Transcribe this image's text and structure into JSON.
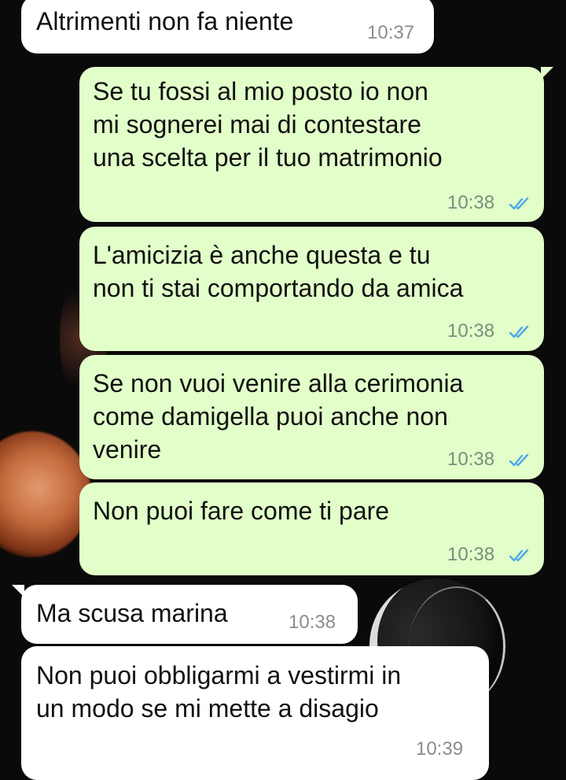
{
  "messages": [
    {
      "id": "m1",
      "direction": "in",
      "text": "Altrimenti non fa niente",
      "time": "10:37"
    },
    {
      "id": "m2",
      "direction": "out",
      "text": "Se tu fossi al mio posto io non\nmi sognerei mai di contestare\nuna scelta per il tuo matrimonio",
      "time": "10:38",
      "status": "read"
    },
    {
      "id": "m3",
      "direction": "out",
      "text": "L'amicizia è anche questa e tu\nnon ti stai comportando da amica",
      "time": "10:38",
      "status": "read"
    },
    {
      "id": "m4",
      "direction": "out",
      "text": "Se non vuoi venire alla cerimonia\ncome damigella puoi anche non\nvenire",
      "time": "10:38",
      "status": "read"
    },
    {
      "id": "m5",
      "direction": "out",
      "text": "Non puoi fare come ti pare",
      "time": "10:38",
      "status": "read"
    },
    {
      "id": "m6",
      "direction": "in",
      "text": "Ma scusa marina",
      "time": "10:38"
    },
    {
      "id": "m7",
      "direction": "in",
      "text": "Non puoi obbligarmi a vestirmi in\nun modo se mi mette a disagio",
      "time": "10:39"
    }
  ],
  "colors": {
    "incoming_bubble": "#ffffff",
    "outgoing_bubble": "#e2fec9",
    "read_ticks": "#4fa8e8",
    "background": "#0b0a0b"
  },
  "icons": {
    "read_receipt": "double-check-icon"
  }
}
